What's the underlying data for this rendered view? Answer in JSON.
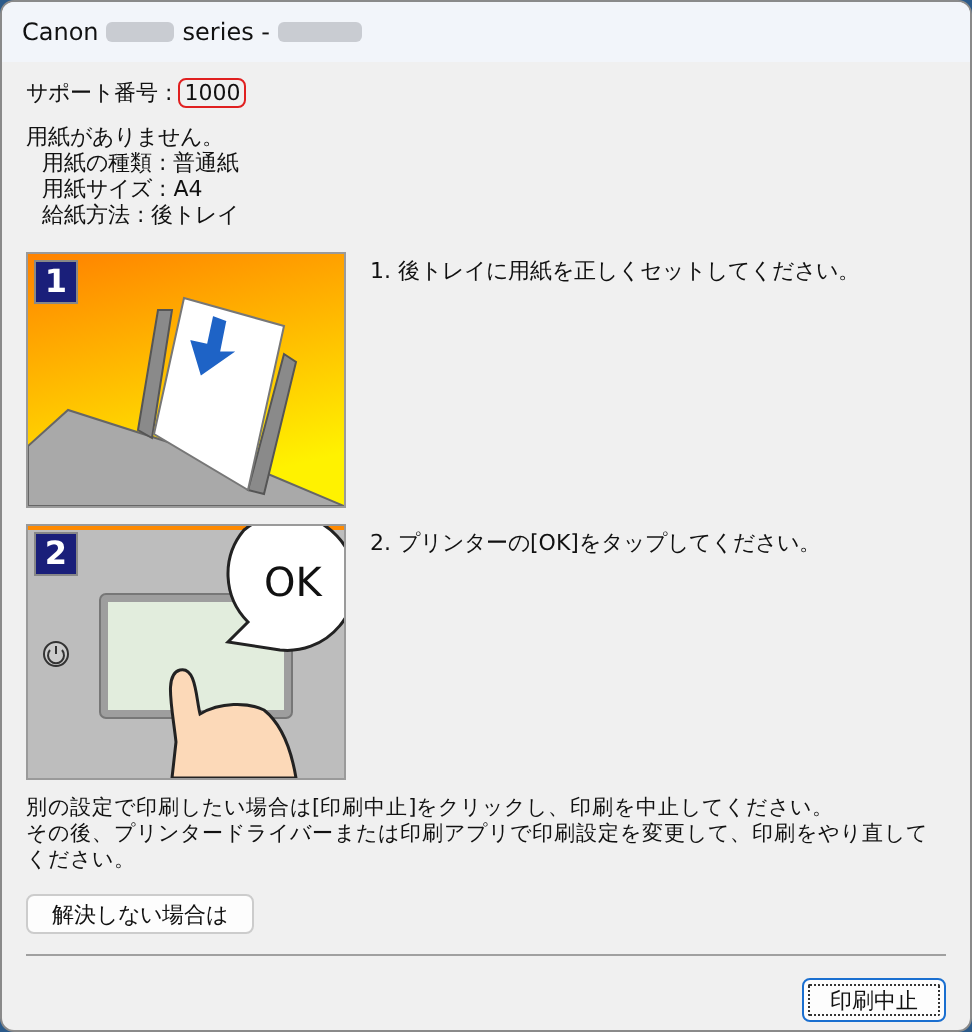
{
  "window": {
    "title_prefix": "Canon",
    "title_middle": "series -"
  },
  "support": {
    "label": "サポート番号 :",
    "code": "1000"
  },
  "message": {
    "heading": "用紙がありません。",
    "details": [
      "用紙の種類 : 普通紙",
      "用紙サイズ : A4",
      "給紙方法 : 後トレイ"
    ]
  },
  "steps": [
    {
      "number": "1",
      "kind": "load-paper",
      "text": "1.  後トレイに用紙を正しくセットしてください。"
    },
    {
      "number": "2",
      "kind": "tap-ok",
      "bubble": "OK",
      "text": "2.  プリンターの[OK]をタップしてください。"
    }
  ],
  "notes": [
    "別の設定で印刷したい場合は[印刷中止]をクリックし、印刷を中止してください。",
    "その後、プリンタードライバーまたは印刷アプリで印刷設定を変更して、印刷をやり直してください。"
  ],
  "help_button": "解決しない場合は",
  "cancel_button": "印刷中止"
}
